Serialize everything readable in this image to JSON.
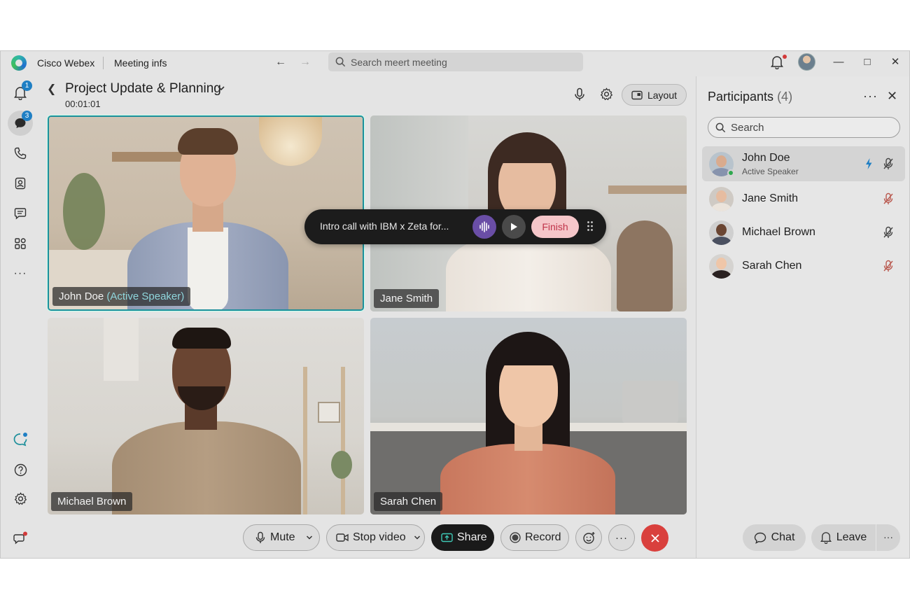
{
  "titlebar": {
    "app_name": "Cisco Webex",
    "section": "Meeting infs",
    "search_placeholder": "Search meert meeting"
  },
  "rail": {
    "notifications_badge": "1",
    "chat_badge": "3"
  },
  "meeting": {
    "title": "Project Update & Planning",
    "timer": "00:01:01",
    "layout_label": "Layout"
  },
  "tiles": [
    {
      "name": "John Doe",
      "suffix": "(Active Speaker)"
    },
    {
      "name": "Jane Smith"
    },
    {
      "name": "Michael Brown"
    },
    {
      "name": "Sarah Chen"
    }
  ],
  "recording": {
    "title": "Intro call with IBM x Zeta for...",
    "finish_label": "Finish"
  },
  "participants": {
    "title": "Participants",
    "count": "(4)",
    "search_placeholder": "Search",
    "items": [
      {
        "name": "John Doe",
        "sub": "Active Speaker"
      },
      {
        "name": "Jane Smith"
      },
      {
        "name": "Michael Brown"
      },
      {
        "name": "Sarah Chen"
      }
    ]
  },
  "controls": {
    "mute": "Mute",
    "stop_video": "Stop video",
    "share": "Share",
    "record": "Record",
    "chat": "Chat",
    "leave": "Leave",
    "more": "···"
  },
  "colors": {
    "accent": "#1d8f9b",
    "end_call": "#d9403d",
    "finish_text": "#c0344a",
    "wave_button": "#6a4ea6"
  }
}
